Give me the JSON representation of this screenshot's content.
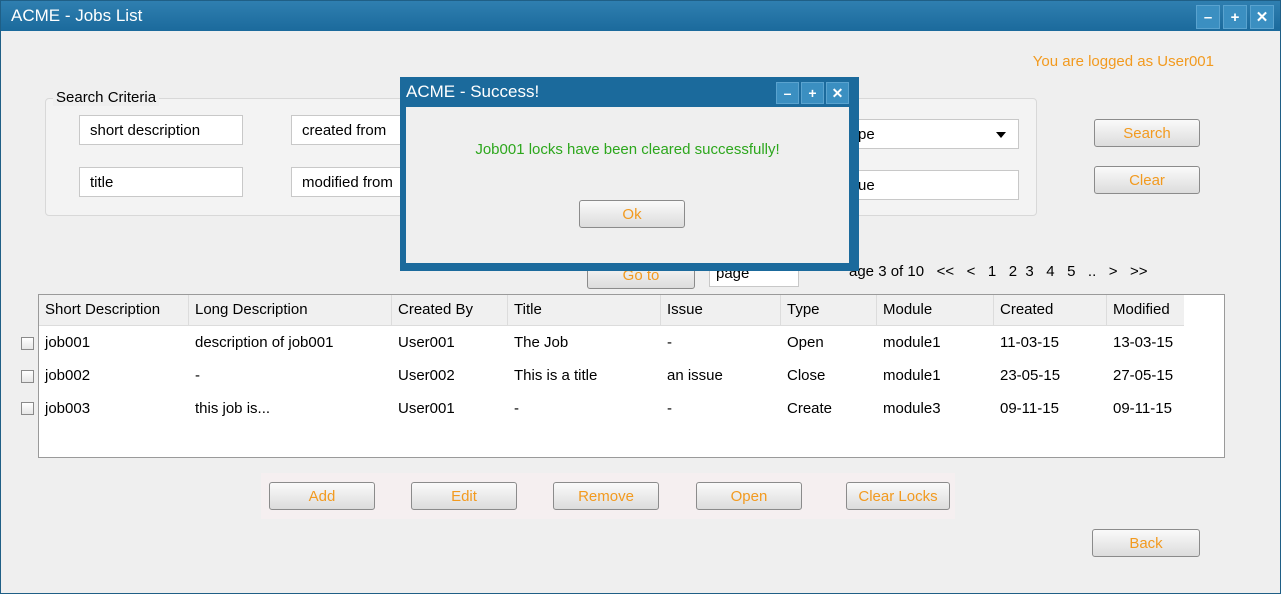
{
  "window": {
    "title": "ACME - Jobs List",
    "controls": [
      "minimize-icon",
      "maximize-icon",
      "close-icon"
    ]
  },
  "user_status": "You are logged as User001",
  "search": {
    "legend": "Search Criteria",
    "fields": {
      "short_description": "short description",
      "created_from": "created from",
      "title": "title",
      "modified_from": "modified from",
      "type_select": "Type",
      "issue": "Issue"
    },
    "visible_type_fragment": "pe",
    "visible_issue_fragment": "ue",
    "search_button": "Search",
    "clear_button": "Clear"
  },
  "pagination": {
    "goto_button": "Go to",
    "page_input": "page",
    "label": "Page 3 of 10",
    "visible_label_fragment": "age 3 of 10",
    "controls": "<<   <   1   2  3   4   5   ..   >   >>"
  },
  "table": {
    "columns": [
      "Short Description",
      "Long Description",
      "Created By",
      "Title",
      "Issue",
      "Type",
      "Module",
      "Created",
      "Modified"
    ],
    "rows": [
      [
        "job001",
        "description of job001",
        "User001",
        "The Job",
        "-",
        "Open",
        "module1",
        "11-03-15",
        "13-03-15"
      ],
      [
        "job002",
        "-",
        "User002",
        "This is a title",
        "an issue",
        "Close",
        "module1",
        "23-05-15",
        "27-05-15"
      ],
      [
        "job003",
        "this job is...",
        "User001",
        "-",
        "-",
        "Create",
        "module3",
        "09-11-15",
        "09-11-15"
      ]
    ]
  },
  "actions": {
    "add": "Add",
    "edit": "Edit",
    "remove": "Remove",
    "open": "Open",
    "clear_locks": "Clear Locks"
  },
  "back_button": "Back",
  "dialog": {
    "title": "ACME - Success!",
    "message": "Job001 locks have been cleared successfully!",
    "ok_button": "Ok",
    "controls": [
      "minimize-icon",
      "maximize-icon",
      "close-icon"
    ]
  },
  "colors": {
    "titlebar": "#1b6a9c",
    "accent_orange": "#f29a1f",
    "success_green": "#2da71d"
  }
}
